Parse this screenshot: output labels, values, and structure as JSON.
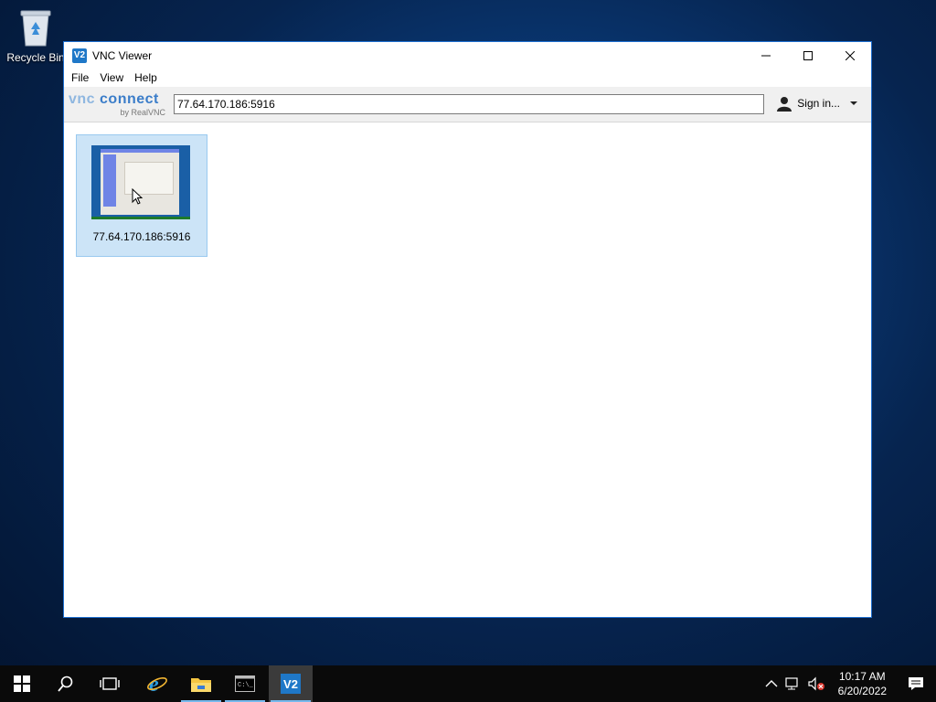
{
  "desktop": {
    "recycle_bin_label": "Recycle Bin"
  },
  "window": {
    "title": "VNC Viewer",
    "app_icon_text": "V2",
    "menu": [
      "File",
      "View",
      "Help"
    ],
    "logo": {
      "brand_light": "vnc",
      "brand_main": " connect",
      "byline": "by RealVNC"
    },
    "address_value": "77.64.170.186:5916",
    "signin_label": "Sign in...",
    "connections": [
      {
        "label": "77.64.170.186:5916",
        "selected": true
      }
    ]
  },
  "taskbar": {
    "items": [
      "start-icon",
      "search-icon",
      "task-view-icon",
      "internet-explorer-icon",
      "file-explorer-icon",
      "command-prompt-icon",
      "vnc-viewer-icon"
    ],
    "time": "10:17 AM",
    "date": "6/20/2022"
  },
  "colors": {
    "accent": "#1e6fd0",
    "selection": "#cce4f7",
    "taskbar": "#0a0a0a"
  }
}
